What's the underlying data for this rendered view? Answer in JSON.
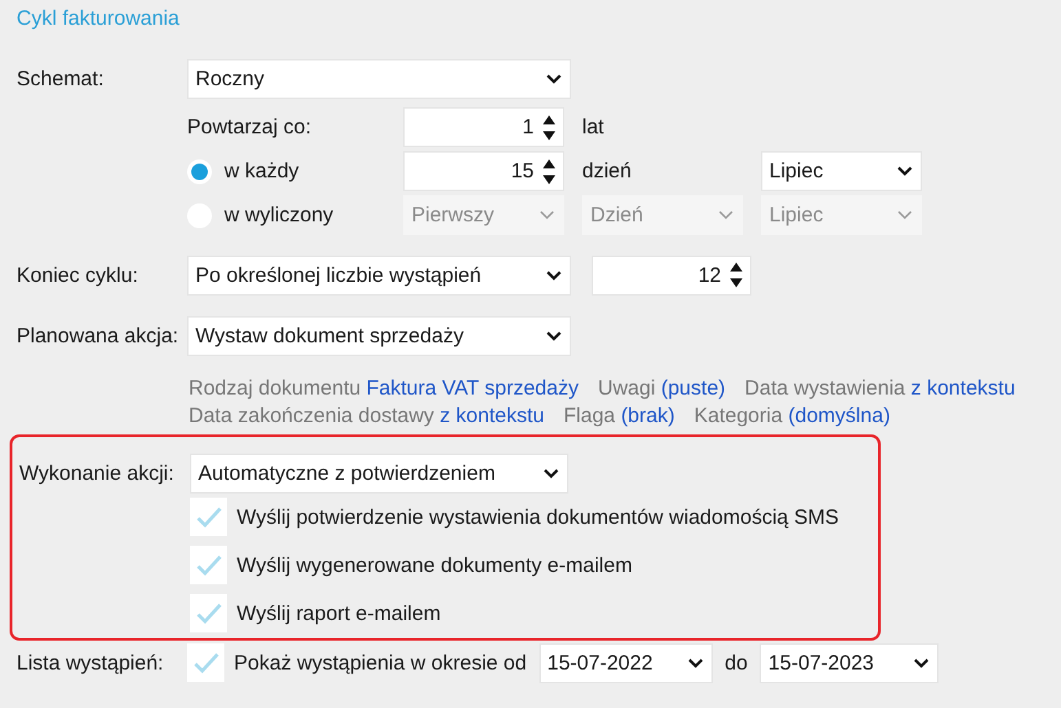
{
  "section_title": "Cykl fakturowania",
  "schedule": {
    "label": "Schemat:",
    "value": "Roczny"
  },
  "repeat": {
    "label": "Powtarzaj co:",
    "value": "1",
    "unit": "lat"
  },
  "day_options": [
    {
      "label": "w każdy",
      "selected": true,
      "controls": [
        {
          "kind": "spin",
          "value": "15",
          "disabled": false
        },
        {
          "kind": "text",
          "value": "dzień"
        },
        {
          "kind": "select",
          "value": "Lipiec",
          "disabled": false
        }
      ]
    },
    {
      "label": "w wyliczony",
      "selected": false,
      "controls": [
        {
          "kind": "select",
          "value": "Pierwszy",
          "disabled": true
        },
        {
          "kind": "select",
          "value": "Dzień",
          "disabled": true
        },
        {
          "kind": "select",
          "value": "Lipiec",
          "disabled": true
        }
      ]
    }
  ],
  "end_of_cycle": {
    "label": "Koniec cyklu:",
    "value": "Po określonej liczbie wystąpień",
    "count": "12"
  },
  "planned_action": {
    "label": "Planowana akcja:",
    "value": "Wystaw dokument sprzedaży"
  },
  "details": [
    [
      {
        "label": "Rodzaj dokumentu",
        "value": "Faktura VAT sprzedaży"
      },
      {
        "label": "Uwagi",
        "value": "(puste)"
      },
      {
        "label": "Data wystawienia",
        "value": "z kontekstu"
      }
    ],
    [
      {
        "label": "Data zakończenia dostawy",
        "value": "z kontekstu"
      },
      {
        "label": "Flaga",
        "value": "(brak)"
      },
      {
        "label": "Kategoria",
        "value": "(domyślna)"
      }
    ]
  ],
  "action_execution": {
    "label": "Wykonanie akcji:",
    "value": "Automatyczne z potwierdzeniem",
    "highlighted": true,
    "options": [
      {
        "label": "Wyślij potwierdzenie wystawienia dokumentów wiadomością SMS",
        "checked": true
      },
      {
        "label": "Wyślij wygenerowane dokumenty e-mailem",
        "checked": true
      },
      {
        "label": "Wyślij raport e-mailem",
        "checked": true
      }
    ]
  },
  "occurrences": {
    "label": "Lista wystąpień:",
    "checked": true,
    "text": "Pokaż wystąpienia w okresie od",
    "from": "15-07-2022",
    "to_label": "do",
    "to": "15-07-2023"
  }
}
